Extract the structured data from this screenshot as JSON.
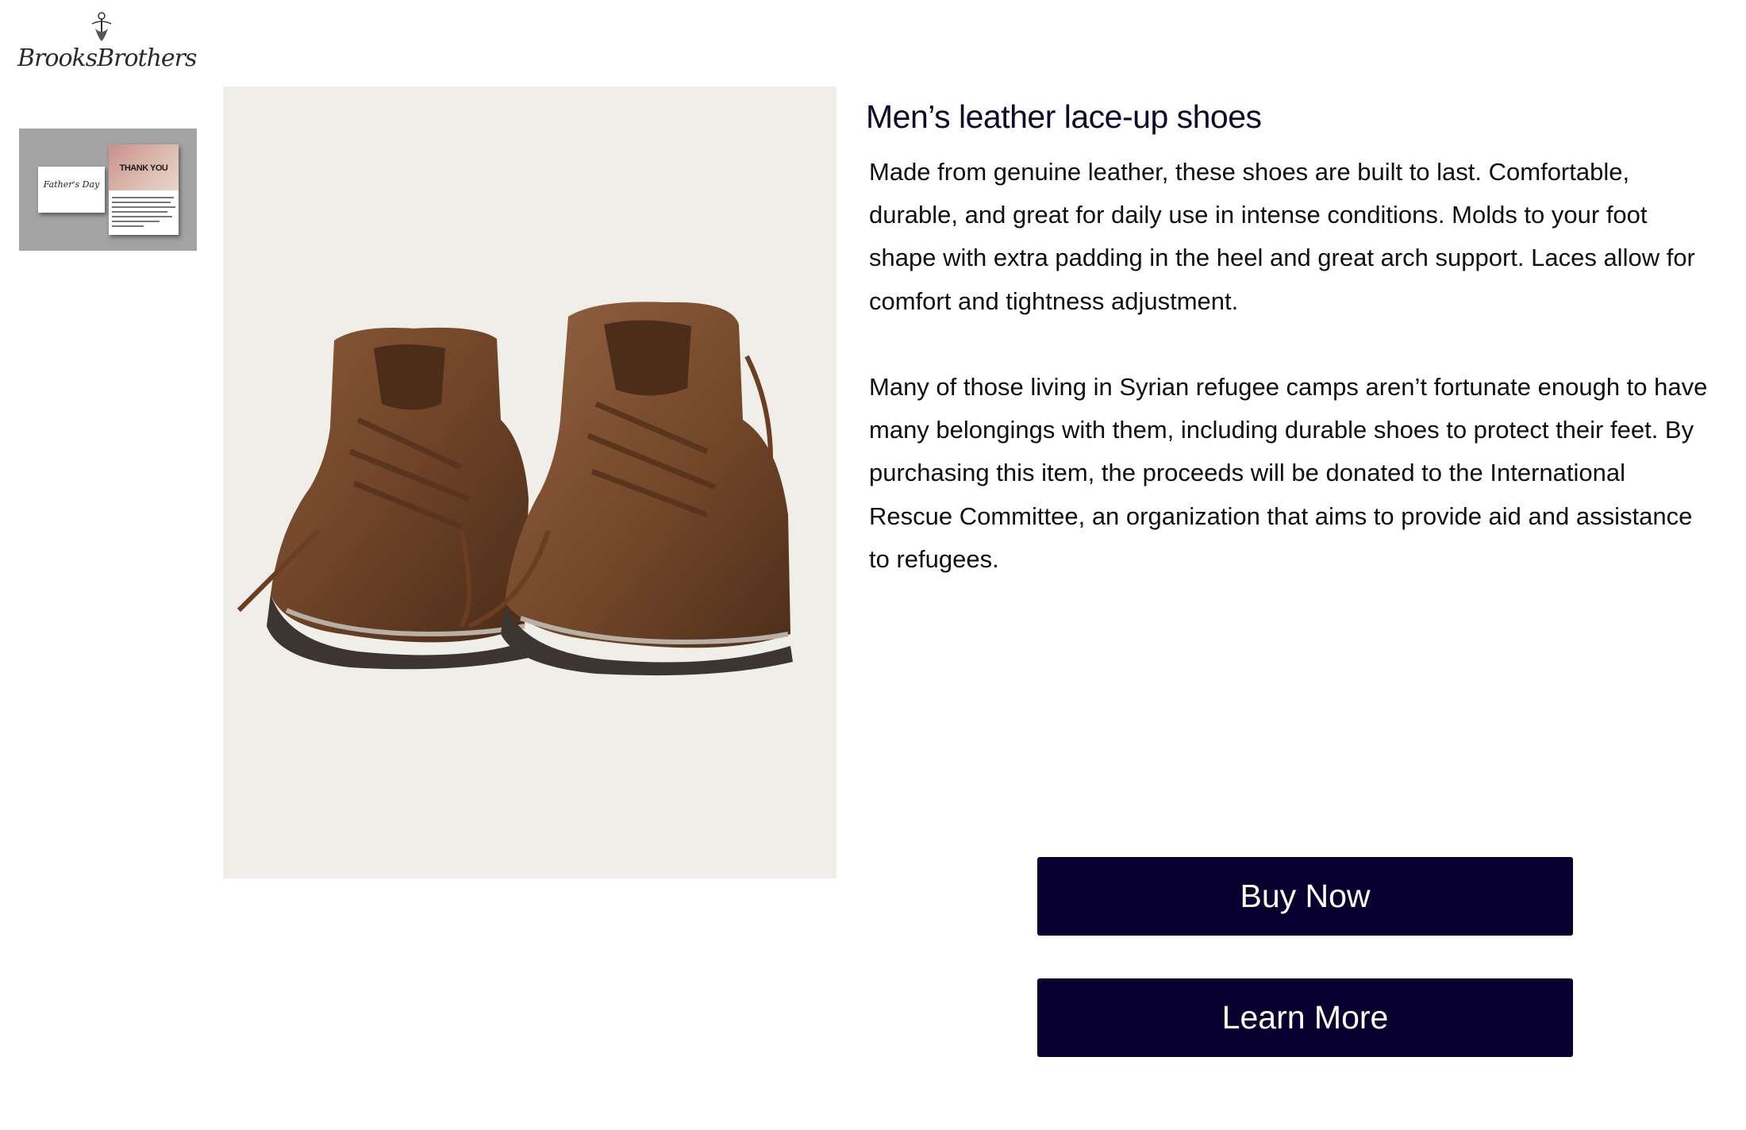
{
  "header": {
    "brand_name": "BrooksBrothers"
  },
  "gallery": {
    "thumbnail": {
      "card_text": "Father's Day",
      "letter_title": "THANK YOU"
    }
  },
  "product": {
    "title": "Men’s leather lace-up shoes",
    "description_1": "Made from genuine leather, these shoes are built to last. Comfortable, durable, and great for daily use in intense conditions. Molds to your foot shape with extra padding in the heel and great arch support. Laces allow for comfort and tightness adjustment.",
    "description_2": "Many of those living in Syrian refugee camps aren’t fortunate enough to have many belongings with them, including durable shoes to protect their feet. By purchasing this item, the proceeds will be donated to the International Rescue Committee, an organization that aims to provide aid and assistance to refugees."
  },
  "actions": {
    "buy_now_label": "Buy Now",
    "learn_more_label": "Learn More"
  },
  "colors": {
    "button_bg": "#08002e",
    "title_text": "#0d0a2c",
    "image_bg": "#efeee8",
    "leather": "#7a4a2b"
  }
}
